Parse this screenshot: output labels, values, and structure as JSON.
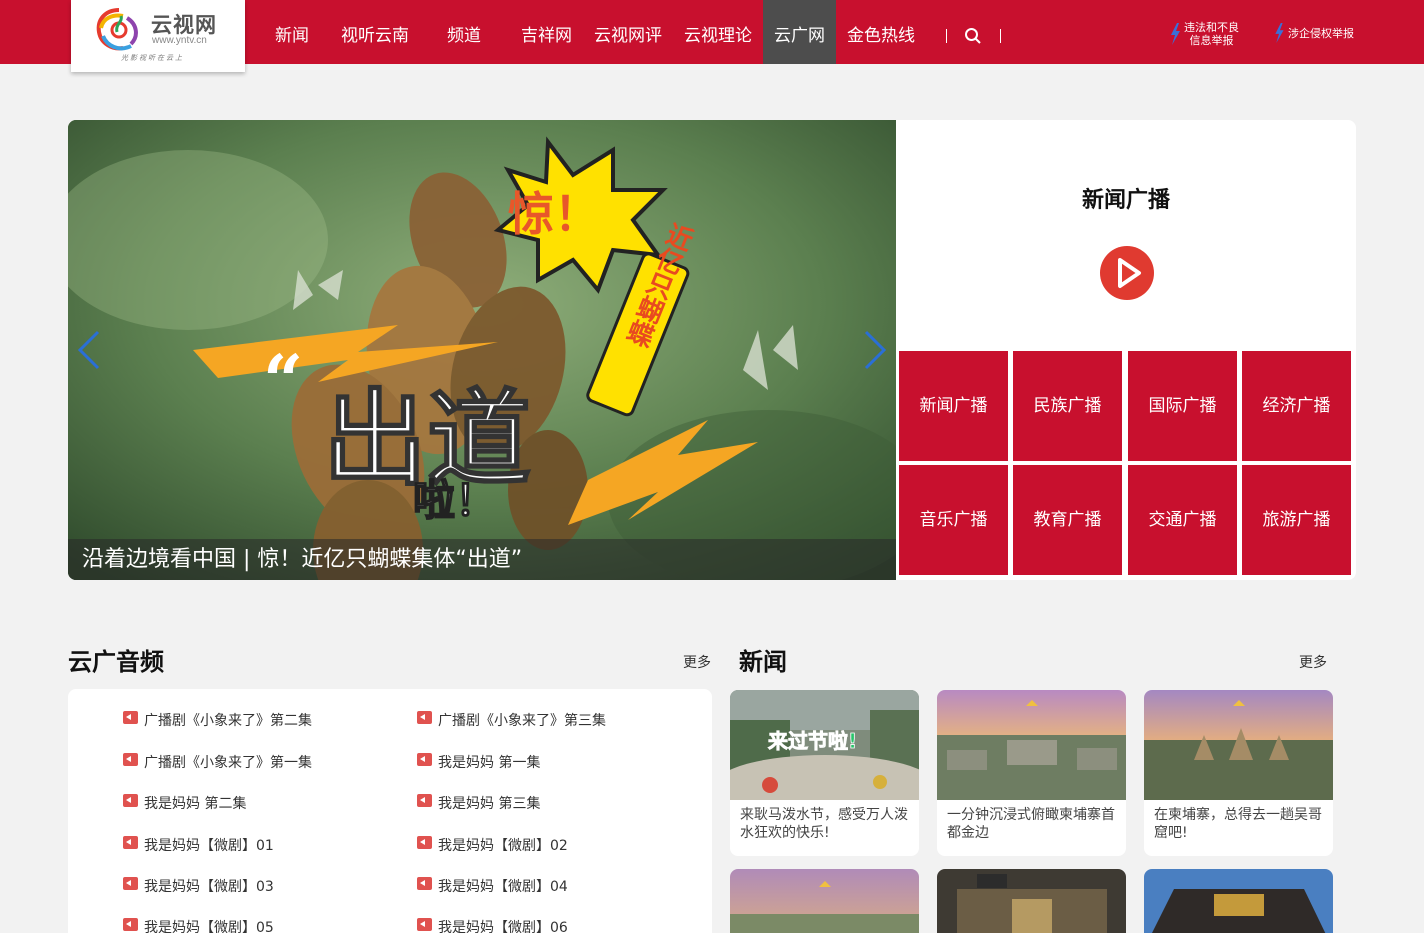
{
  "brand": {
    "name": "云视网",
    "url": "www.yntv.cn",
    "slogan": "光影视听在云上"
  },
  "nav": {
    "items": [
      "新闻",
      "视听云南",
      "频道",
      "吉祥网",
      "云视网评",
      "云视理论",
      "云广网",
      "金色热线"
    ],
    "active": "云广网",
    "reports": [
      "违法和不良信息举报",
      "涉企侵权举报"
    ],
    "report1_line1": "违法和不良",
    "report1_line2": "信息举报",
    "report2": "涉企侵权举报"
  },
  "hero": {
    "caption": "沿着边境看中国 | 惊！近亿只蝴蝶集体“出道”",
    "art_text": {
      "burst": "惊！",
      "tag": "近亿只蝴蝶",
      "main": "出道",
      "sub": "啦！"
    }
  },
  "radio": {
    "title": "新闻广播",
    "channels": [
      "新闻广播",
      "民族广播",
      "国际广播",
      "经济广播",
      "音乐广播",
      "教育广播",
      "交通广播",
      "旅游广播"
    ]
  },
  "audio": {
    "title": "云广音频",
    "more": "更多",
    "items": [
      "广播剧《小象来了》第二集",
      "广播剧《小象来了》第三集",
      "广播剧《小象来了》第一集",
      "我是妈妈 第一集",
      "我是妈妈 第二集",
      "我是妈妈 第三集",
      "我是妈妈【微剧】01",
      "我是妈妈【微剧】02",
      "我是妈妈【微剧】03",
      "我是妈妈【微剧】04",
      "我是妈妈【微剧】05",
      "我是妈妈【微剧】06"
    ]
  },
  "news": {
    "title": "新闻",
    "more": "更多",
    "cards": [
      {
        "text": "来耿马泼水节，感受万人泼水狂欢的快乐!",
        "thumb_text": "来过节啦!"
      },
      {
        "text": "一分钟沉浸式俯瞰柬埔寨首都金边",
        "thumb_text": ""
      },
      {
        "text": "在柬埔寨，总得去一趟吴哥窟吧!",
        "thumb_text": ""
      }
    ]
  },
  "colors": {
    "brand_red": "#c8102e",
    "active_nav": "#4d4d4d",
    "play_red": "#e03a30",
    "page_bg": "#f2f2f2"
  }
}
